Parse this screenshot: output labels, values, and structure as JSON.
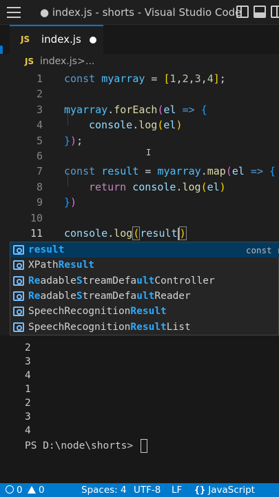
{
  "window": {
    "title": "● index.js - shorts - Visual Studio Code"
  },
  "tab": {
    "icon_text": "JS",
    "label": "index.js"
  },
  "breadcrumb": {
    "icon_text": "JS",
    "file": "index.js",
    "separator": ">",
    "more": "..."
  },
  "editor": {
    "lines": [
      {
        "number": "1",
        "text": "const myarray = [1,2,3,4];"
      },
      {
        "number": "2",
        "text": ""
      },
      {
        "number": "3",
        "text": "myarray.forEach(el => {"
      },
      {
        "number": "4",
        "text": "    console.log(el)"
      },
      {
        "number": "5",
        "text": "});"
      },
      {
        "number": "6",
        "text": ""
      },
      {
        "number": "7",
        "text": "const result = myarray.map(el => {"
      },
      {
        "number": "8",
        "text": "    return console.log(el)"
      },
      {
        "number": "9",
        "text": "})"
      },
      {
        "number": "10",
        "text": ""
      },
      {
        "number": "11",
        "text": "console.log(result)"
      }
    ],
    "tokens": {
      "l1": [
        "const",
        " ",
        "myarray",
        " = ",
        "[",
        "1",
        ",",
        "2",
        ",",
        "3",
        ",",
        "4",
        "]",
        ";"
      ],
      "l3": [
        "myarray",
        ".",
        "forEach",
        "(",
        "el",
        " => ",
        "{"
      ],
      "l4": [
        "console",
        ".",
        "log",
        "(",
        "el",
        ")"
      ],
      "l5": [
        "}",
        ")",
        ";"
      ],
      "l7": [
        "const",
        " ",
        "result",
        " = ",
        "myarray",
        ".",
        "map",
        "(",
        "el",
        " => ",
        "{"
      ],
      "l8": [
        "return",
        " ",
        "console",
        ".",
        "log",
        "(",
        "el",
        ")"
      ],
      "l9": [
        "}",
        ")"
      ],
      "l11": [
        "console",
        ".",
        "log",
        "(",
        "result",
        ")"
      ]
    }
  },
  "suggest": {
    "items": [
      {
        "pre": "",
        "hl1": "result",
        "mid": "",
        "hl2": "",
        "post": "",
        "detail": "const r"
      },
      {
        "pre": "XPath",
        "hl1": "Result",
        "mid": "",
        "hl2": "",
        "post": "",
        "detail": ""
      },
      {
        "pre": "",
        "hl1": "Re",
        "mid": "adable",
        "hl2": "S",
        "post": "treamDefa",
        "hl3": "ult",
        "tail": "Controller",
        "hl0": "",
        "detail": ""
      },
      {
        "pre": "",
        "hl1": "Re",
        "mid": "adable",
        "hl2": "S",
        "post": "treamDefa",
        "hl3": "ult",
        "tail": "Reader",
        "detail": ""
      },
      {
        "pre": "SpeechRecognition",
        "hl1": "Result",
        "mid": "",
        "hl2": "",
        "post": "",
        "detail": ""
      },
      {
        "pre": "SpeechRecognition",
        "hl1": "Result",
        "mid": "List",
        "hl2": "",
        "post": "",
        "detail": ""
      }
    ]
  },
  "terminal": {
    "lines": [
      "2",
      "3",
      "4",
      "1",
      "2",
      "3",
      "4"
    ],
    "prompt": "PS D:\\node\\shorts> "
  },
  "statusbar": {
    "errors": "0",
    "warnings": "0",
    "spaces": "Spaces: 4",
    "encoding": "UTF-8",
    "eol": "LF",
    "language_icon": "{}",
    "language": "JavaScript"
  },
  "colors": {
    "accent": "#007acc",
    "keyword": "#569cd6",
    "function": "#dcdcaa",
    "match_highlight": "#2aaaff"
  }
}
